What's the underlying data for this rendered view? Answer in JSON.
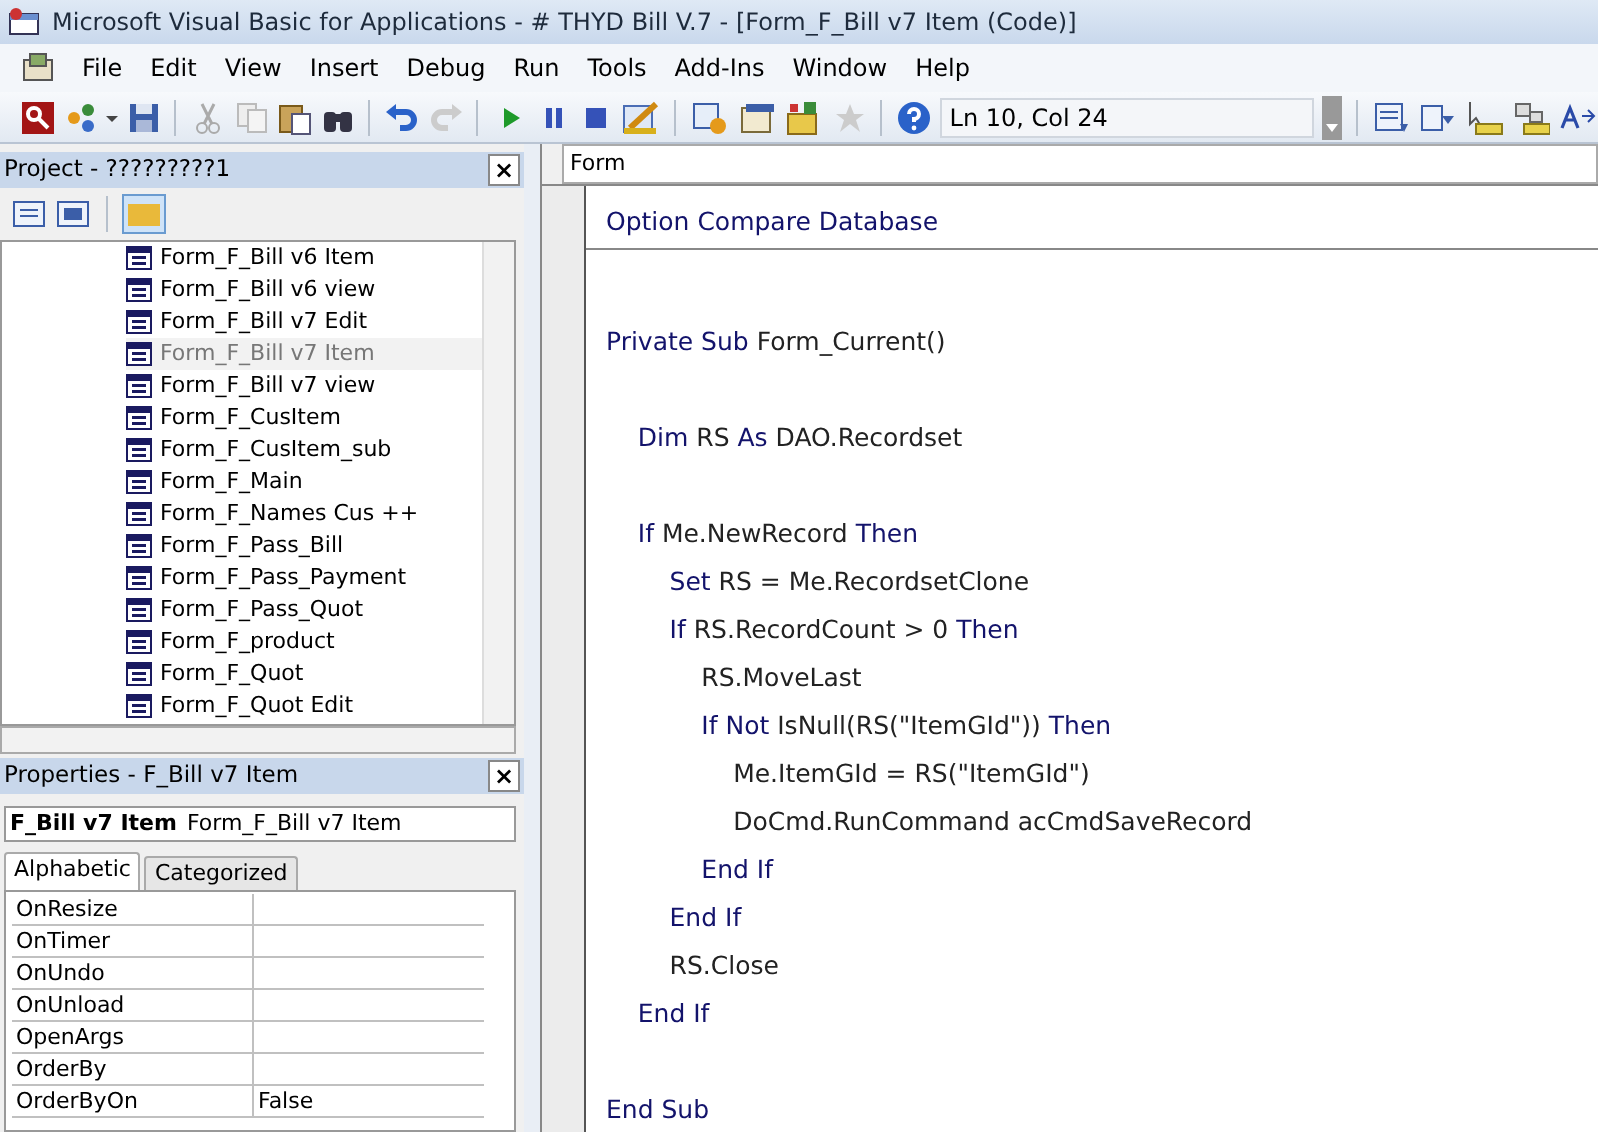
{
  "window": {
    "title": "Microsoft Visual Basic for Applications - # THYD Bill V.7 - [Form_F_Bill v7 Item (Code)]"
  },
  "menu": [
    "File",
    "Edit",
    "View",
    "Insert",
    "Debug",
    "Run",
    "Tools",
    "Add-Ins",
    "Window",
    "Help"
  ],
  "toolbar": {
    "position": "Ln 10, Col 24"
  },
  "project": {
    "title": "Project - ?????????1",
    "close": "×",
    "items": [
      {
        "label": "Form_F_Bill v6 Item",
        "selected": false
      },
      {
        "label": "Form_F_Bill v6 view",
        "selected": false
      },
      {
        "label": "Form_F_Bill v7 Edit",
        "selected": false
      },
      {
        "label": "Form_F_Bill v7 Item",
        "selected": true
      },
      {
        "label": "Form_F_Bill v7 view",
        "selected": false
      },
      {
        "label": "Form_F_CusItem",
        "selected": false
      },
      {
        "label": "Form_F_CusItem_sub",
        "selected": false
      },
      {
        "label": "Form_F_Main",
        "selected": false
      },
      {
        "label": "Form_F_Names Cus ++",
        "selected": false
      },
      {
        "label": "Form_F_Pass_Bill",
        "selected": false
      },
      {
        "label": "Form_F_Pass_Payment",
        "selected": false
      },
      {
        "label": "Form_F_Pass_Quot",
        "selected": false
      },
      {
        "label": "Form_F_product",
        "selected": false
      },
      {
        "label": "Form_F_Quot",
        "selected": false
      },
      {
        "label": "Form_F_Quot Edit",
        "selected": false
      }
    ]
  },
  "properties": {
    "title": "Properties - F_Bill v7 Item",
    "close": "×",
    "object_name": "F_Bill v7 Item",
    "object_type": "Form_F_Bill v7 Item",
    "tabs": [
      {
        "label": "Alphabetic",
        "selected": true
      },
      {
        "label": "Categorized",
        "selected": false
      }
    ],
    "rows": [
      {
        "name": "OnResize"
      },
      {
        "name": "OnTimer"
      },
      {
        "name": "OnUndo"
      },
      {
        "name": "OnUnload"
      },
      {
        "name": "OpenArgs"
      },
      {
        "name": "OrderBy"
      },
      {
        "name": "OrderByOn",
        "value": "False"
      }
    ]
  },
  "code": {
    "object": "Form",
    "lines": [
      {
        "kind": "declaration",
        "tokens": [
          {
            "text": "Option Compare Database",
            "kind": "keyword"
          }
        ]
      },
      {
        "kind": "blank"
      },
      {
        "kind": "code",
        "tokens": [
          {
            "text": "Private Sub",
            "kind": "keyword"
          },
          {
            "text": " Form_Current()",
            "kind": "plain"
          }
        ]
      },
      {
        "kind": "blank"
      },
      {
        "kind": "code",
        "tokens": [
          {
            "text": "    Dim",
            "kind": "keyword"
          },
          {
            "text": " RS ",
            "kind": "plain"
          },
          {
            "text": "As",
            "kind": "keyword"
          },
          {
            "text": " DAO.Recordset",
            "kind": "plain"
          }
        ]
      },
      {
        "kind": "blank"
      },
      {
        "kind": "code",
        "tokens": [
          {
            "text": "    If",
            "kind": "keyword"
          },
          {
            "text": " Me.NewRecord ",
            "kind": "plain"
          },
          {
            "text": "Then",
            "kind": "keyword"
          }
        ]
      },
      {
        "kind": "code",
        "tokens": [
          {
            "text": "        Set",
            "kind": "keyword"
          },
          {
            "text": " RS = Me.RecordsetClone",
            "kind": "plain"
          }
        ]
      },
      {
        "kind": "code",
        "tokens": [
          {
            "text": "        If",
            "kind": "keyword"
          },
          {
            "text": " RS.RecordCount > 0 ",
            "kind": "plain"
          },
          {
            "text": "Then",
            "kind": "keyword"
          }
        ]
      },
      {
        "kind": "code",
        "tokens": [
          {
            "text": "            RS.MoveLast",
            "kind": "plain"
          }
        ]
      },
      {
        "kind": "code",
        "tokens": [
          {
            "text": "            If Not",
            "kind": "keyword"
          },
          {
            "text": " IsNull(RS(\"ItemGId\")) ",
            "kind": "plain"
          },
          {
            "text": "Then",
            "kind": "keyword"
          }
        ]
      },
      {
        "kind": "code",
        "tokens": [
          {
            "text": "                Me.ItemGId = RS(\"ItemGId\")",
            "kind": "plain"
          }
        ]
      },
      {
        "kind": "code",
        "tokens": [
          {
            "text": "                DoCmd.RunCommand acCmdSaveRecord",
            "kind": "plain"
          }
        ]
      },
      {
        "kind": "code",
        "tokens": [
          {
            "text": "            End If",
            "kind": "keyword"
          }
        ]
      },
      {
        "kind": "code",
        "tokens": [
          {
            "text": "        End If",
            "kind": "keyword"
          }
        ]
      },
      {
        "kind": "code",
        "tokens": [
          {
            "text": "        RS.Close",
            "kind": "plain"
          }
        ]
      },
      {
        "kind": "code",
        "tokens": [
          {
            "text": "    End If",
            "kind": "keyword"
          }
        ]
      },
      {
        "kind": "blank"
      },
      {
        "kind": "code",
        "tokens": [
          {
            "text": "End Sub",
            "kind": "keyword"
          }
        ]
      }
    ]
  }
}
